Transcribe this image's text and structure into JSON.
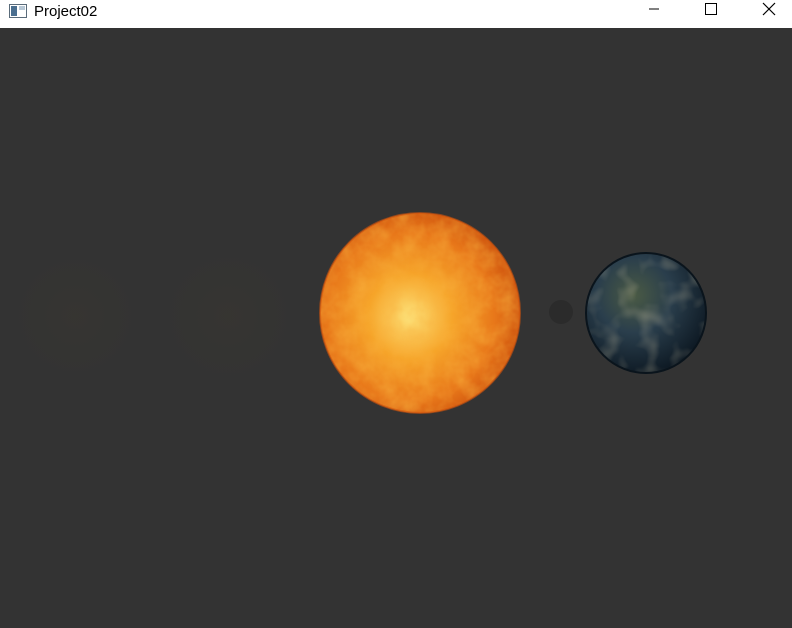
{
  "window": {
    "title": "Project02",
    "icon": "app-window-icon",
    "controls": {
      "minimize_icon": "minimize-icon",
      "maximize_icon": "maximize-icon",
      "close_icon": "close-icon"
    }
  },
  "scene": {
    "background_color": "#333333",
    "bodies": [
      {
        "name": "sun",
        "colors": [
          "#fde27a",
          "#f4961c",
          "#d9640d",
          "#c5470a"
        ]
      },
      {
        "name": "moon",
        "colors": [
          "#2b2b2b"
        ]
      },
      {
        "name": "earth",
        "colors": [
          "#3b4a3a",
          "#1f3343",
          "#0e1b26"
        ]
      }
    ]
  }
}
